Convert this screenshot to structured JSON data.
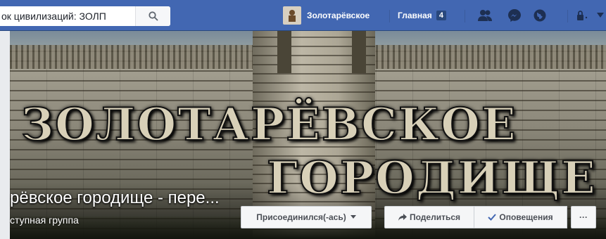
{
  "topbar": {
    "search_value": "ок цивилизаций: ЗОЛП",
    "profile_name": "Золотарёвское",
    "home_label": "Главная",
    "home_count": "4"
  },
  "cover": {
    "title_line1": "ЗОЛОТАРЁВСКОЕ",
    "title_line2": "ГОРОДИЩЕ"
  },
  "group": {
    "name": "рёвское городище - пере...",
    "privacy": "ступная группа"
  },
  "actions": {
    "joined_label": "Присоединился(-ась)",
    "share_label": "Поделиться",
    "notifications_label": "Оповещения",
    "more_label": "···"
  },
  "icons": [
    "search-icon",
    "friend-requests-icon",
    "messenger-icon",
    "notifications-globe-icon",
    "privacy-lock-icon",
    "account-caret-icon",
    "share-arrow-icon",
    "checkmark-icon",
    "dropdown-caret-icon"
  ],
  "colors": {
    "topbar": "#4267b2",
    "accent": "#4267b2"
  }
}
